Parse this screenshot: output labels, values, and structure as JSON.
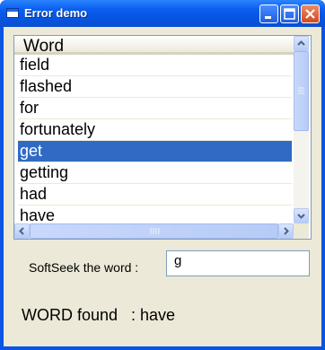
{
  "window": {
    "title": "Error demo"
  },
  "list": {
    "header": "Word",
    "items": [
      {
        "label": "field",
        "selected": false
      },
      {
        "label": "flashed",
        "selected": false
      },
      {
        "label": "for",
        "selected": false
      },
      {
        "label": "fortunately",
        "selected": false
      },
      {
        "label": "get",
        "selected": true
      },
      {
        "label": "getting",
        "selected": false
      },
      {
        "label": "had",
        "selected": false
      },
      {
        "label": "have",
        "selected": false
      }
    ]
  },
  "search": {
    "label": "SoftSeek the word :",
    "value": "g"
  },
  "result": {
    "text": "WORD found   : have"
  },
  "colors": {
    "selection": "#316ac5",
    "titlebar": "#0b5ef0",
    "client": "#ece9d8"
  }
}
